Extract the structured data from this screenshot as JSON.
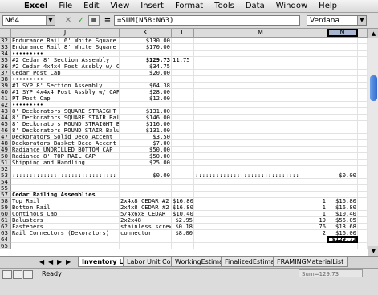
{
  "app": {
    "menus": [
      "Excel",
      "File",
      "Edit",
      "View",
      "Insert",
      "Format",
      "Tools",
      "Data",
      "Window",
      "Help"
    ]
  },
  "formula_bar": {
    "name_box": "N64",
    "formula": "=SUM(N58:N63)",
    "font": "Verdana",
    "cancel": "✕",
    "enter": "✓",
    "equals": "="
  },
  "columns": [
    "J",
    "K",
    "L",
    "M",
    "N"
  ],
  "rows": [
    {
      "n": "32",
      "j": "Endurance Rail 6' White Square  STAIF",
      "k": "$130.00",
      "l": "",
      "m": "",
      "nn": ""
    },
    {
      "n": "33",
      "j": "Endurance Rail 8' White Square  STAIR",
      "k": "$170.00",
      "l": "",
      "m": "",
      "nn": ""
    },
    {
      "n": "34",
      "j": "•••••••••",
      "k": "",
      "l": "",
      "m": "",
      "nn": ""
    },
    {
      "n": "35",
      "j": "#2 Cedar 8' Section Assembly",
      "k": "$129.73",
      "l": "11.75 for x4x4",
      "m": "",
      "nn": "",
      "kb": true
    },
    {
      "n": "36",
      "j": "#2 Cedar 4x4x4 Post Assbly w/ CAP",
      "k": "$34.75",
      "l": "",
      "m": "",
      "nn": ""
    },
    {
      "n": "37",
      "j": "Cedar Post Cap",
      "k": "$20.00",
      "l": "",
      "m": "",
      "nn": ""
    },
    {
      "n": "38",
      "j": "•••••••••",
      "k": "",
      "l": "",
      "m": "",
      "nn": ""
    },
    {
      "n": "39",
      "j": "#1 SYP 8' Section Assembly",
      "k": "$64.38",
      "l": "",
      "m": "",
      "nn": ""
    },
    {
      "n": "40",
      "j": "#1 SYP 4x4x4 Post Assbly w/ CAP",
      "k": "$28.00",
      "l": "",
      "m": "",
      "nn": ""
    },
    {
      "n": "41",
      "j": "PT Post Cap",
      "k": "$12.00",
      "l": "",
      "m": "",
      "nn": ""
    },
    {
      "n": "42",
      "j": "•••••••••",
      "k": "",
      "l": "",
      "m": "",
      "nn": ""
    },
    {
      "n": "43",
      "j": "8' Deckorators SQUARE STRAIGHT  Ba",
      "k": "$131.00",
      "l": "",
      "m": "",
      "nn": ""
    },
    {
      "n": "44",
      "j": "8' Deckorators SQUARE STAIR  Balust",
      "k": "$146.00",
      "l": "",
      "m": "",
      "nn": ""
    },
    {
      "n": "45",
      "j": "8' Deckorators ROUND STRAIGHT  Bal",
      "k": "$116.00",
      "l": "",
      "m": "",
      "nn": ""
    },
    {
      "n": "46",
      "j": "8' Deckorators ROUND STAIR  Baluste",
      "k": "$131.00",
      "l": "",
      "m": "",
      "nn": ""
    },
    {
      "n": "47",
      "j": "Deckorators Solid Deco Accent",
      "k": "$3.50",
      "l": "",
      "m": "",
      "nn": ""
    },
    {
      "n": "48",
      "j": "Deckorators Basket Deco Accent",
      "k": "$7.00",
      "l": "",
      "m": "",
      "nn": ""
    },
    {
      "n": "49",
      "j": "Radiance UNDRILLED BOTTOM CAP",
      "k": "$50.00",
      "l": "",
      "m": "",
      "nn": ""
    },
    {
      "n": "50",
      "j": "Radiance 8' TOP RAIL CAP",
      "k": "$50.00",
      "l": "",
      "m": "",
      "nn": ""
    },
    {
      "n": "51",
      "j": "Shipping and Handling",
      "k": "$25.00",
      "l": "",
      "m": "",
      "nn": ""
    },
    {
      "n": "52",
      "j": "",
      "k": "",
      "l": "",
      "m": "",
      "nn": ""
    },
    {
      "n": "53",
      "j": "::::::::::::::::::::::::::::::",
      "k": "$0.00",
      "l": "",
      "m": "::::::::::::::::::::::::::::::",
      "nn": "$0.00"
    },
    {
      "n": "54",
      "j": "",
      "k": "",
      "l": "",
      "m": "",
      "nn": ""
    },
    {
      "n": "55",
      "j": "",
      "k": "",
      "l": "",
      "m": "",
      "nn": ""
    },
    {
      "n": "57",
      "j": "Cedar Railing Assemblies",
      "k": "",
      "l": "",
      "m": "",
      "nn": "",
      "jb": true
    },
    {
      "n": "58",
      "j": "Top Rail",
      "k": "2x4x8 CEDAR #2",
      "l": "$16.80",
      "m": "1",
      "nn": "$16.80"
    },
    {
      "n": "59",
      "j": "Bottom Rail",
      "k": "2x4x8 CEDAR #2",
      "l": "$16.80",
      "m": "1",
      "nn": "$16.80"
    },
    {
      "n": "60",
      "j": "Continous Cap",
      "k": "5/4x6x8 CEDAR",
      "l": "$10.40",
      "m": "1",
      "nn": "$10.40"
    },
    {
      "n": "61",
      "j": "Balusters",
      "k": "2x2x48",
      "l": "$2.95",
      "m": "19",
      "nn": "$56.05"
    },
    {
      "n": "62",
      "j": "Fasteners",
      "k": "stainless screws",
      "l": "$0.18",
      "m": "76",
      "nn": "$13.68"
    },
    {
      "n": "63",
      "j": "Rail Connectors (Dekorators)",
      "k": "connector",
      "l": "$8.00",
      "m": "2",
      "nn": "$16.00"
    },
    {
      "n": "64",
      "j": "",
      "k": "",
      "l": "",
      "m": "",
      "nn": "$129.73",
      "nb": true
    },
    {
      "n": "65",
      "j": "",
      "k": "",
      "l": "",
      "m": "",
      "nn": ""
    }
  ],
  "sheet_tabs": [
    "Inventory List",
    "Labor Unit Costs",
    "WorkingEstimate",
    "FinalizedEstimate",
    "FRAMINGMaterialList"
  ],
  "active_tab": "Inventory List",
  "status": {
    "mode": "Ready",
    "sum": "Sum=129.73"
  }
}
